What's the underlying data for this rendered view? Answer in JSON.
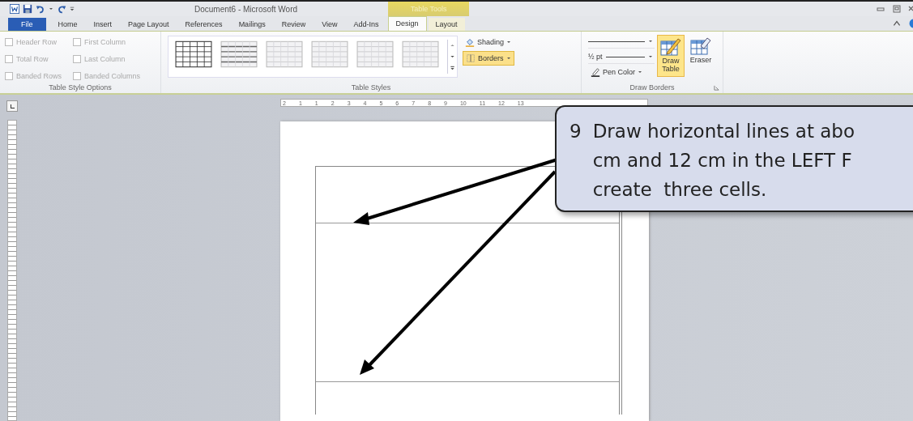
{
  "window": {
    "title": "Document6 - Microsoft Word",
    "context_group": "Table Tools"
  },
  "tabs": [
    {
      "label": "File",
      "kind": "file",
      "selected": false
    },
    {
      "label": "Home",
      "kind": "plain",
      "selected": false
    },
    {
      "label": "Insert",
      "kind": "plain",
      "selected": false
    },
    {
      "label": "Page Layout",
      "kind": "plain",
      "selected": false
    },
    {
      "label": "References",
      "kind": "plain",
      "selected": false
    },
    {
      "label": "Mailings",
      "kind": "plain",
      "selected": false
    },
    {
      "label": "Review",
      "kind": "plain",
      "selected": false
    },
    {
      "label": "View",
      "kind": "plain",
      "selected": false
    },
    {
      "label": "Add-Ins",
      "kind": "plain",
      "selected": false
    },
    {
      "label": "Design",
      "kind": "context",
      "selected": true
    },
    {
      "label": "Layout",
      "kind": "context",
      "selected": false
    }
  ],
  "ribbon": {
    "table_style_options": {
      "label": "Table Style Options",
      "options": [
        {
          "label": "Header Row",
          "checked": false,
          "disabled": true
        },
        {
          "label": "First Column",
          "checked": false,
          "disabled": true
        },
        {
          "label": "Total Row",
          "checked": false,
          "disabled": true
        },
        {
          "label": "Last Column",
          "checked": false,
          "disabled": true
        },
        {
          "label": "Banded Rows",
          "checked": false,
          "disabled": true
        },
        {
          "label": "Banded Columns",
          "checked": false,
          "disabled": true
        }
      ]
    },
    "table_styles": {
      "label": "Table Styles",
      "shading": {
        "label": "Shading"
      },
      "borders": {
        "label": "Borders",
        "on": true
      }
    },
    "draw_borders": {
      "label": "Draw Borders",
      "pen_weight": "½ pt",
      "pen_color": "Pen Color",
      "buttons": [
        {
          "label": "Draw Table",
          "kind": "pencil",
          "selected": true
        },
        {
          "label": "Eraser",
          "kind": "eraser",
          "selected": false
        }
      ]
    }
  },
  "ruler": {
    "labels": [
      "2",
      "1",
      "1",
      "2",
      "3",
      "4",
      "5",
      "6",
      "7",
      "8",
      "9",
      "10",
      "11",
      "12",
      "13"
    ]
  },
  "callout": {
    "number": "9",
    "lines": [
      "Draw horizontal lines at abo",
      "cm and 12 cm in the LEFT F",
      "create  three cells."
    ]
  }
}
